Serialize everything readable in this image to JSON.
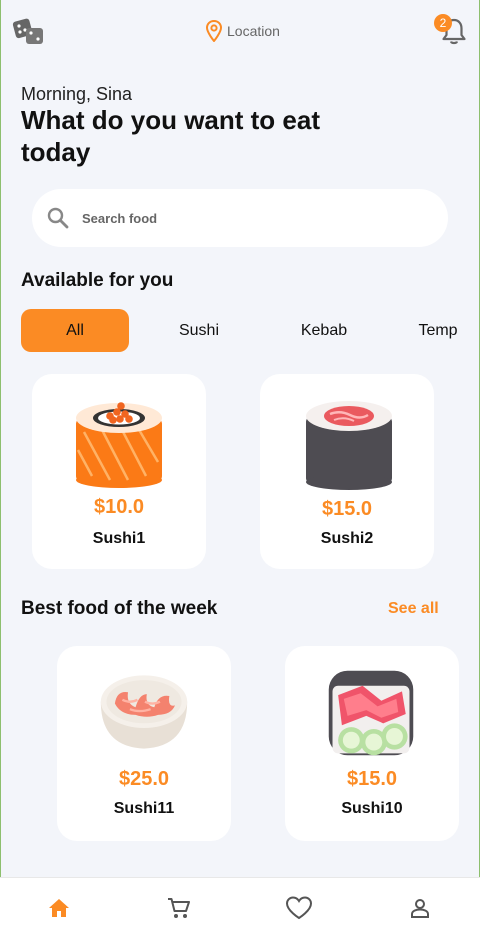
{
  "header": {
    "location_label": "Location",
    "notification_count": "2"
  },
  "greeting": "Morning, Sina",
  "headline": "What do you want to eat today",
  "search": {
    "placeholder": "Search food"
  },
  "available": {
    "title": "Available for you",
    "tabs": [
      {
        "label": "All",
        "active": true
      },
      {
        "label": "Sushi",
        "active": false
      },
      {
        "label": "Kebab",
        "active": false
      },
      {
        "label": "Temp",
        "active": false
      }
    ],
    "items": [
      {
        "price": "$10.0",
        "name": "Sushi1",
        "icon": "salmon-roll-icon"
      },
      {
        "price": "$15.0",
        "name": "Sushi2",
        "icon": "nori-roll-icon"
      }
    ]
  },
  "best": {
    "title": "Best food of the week",
    "see_all": "See all",
    "items": [
      {
        "price": "$25.0",
        "name": "Sushi11",
        "icon": "shrimp-bowl-icon"
      },
      {
        "price": "$15.0",
        "name": "Sushi10",
        "icon": "tuna-cucumber-roll-icon"
      }
    ]
  },
  "nav": [
    {
      "name": "home",
      "icon": "home-icon",
      "active": true
    },
    {
      "name": "cart",
      "icon": "cart-icon",
      "active": false
    },
    {
      "name": "favorites",
      "icon": "heart-icon",
      "active": false
    },
    {
      "name": "profile",
      "icon": "person-icon",
      "active": false
    }
  ],
  "colors": {
    "accent": "#fb8b24",
    "background": "#f3f5fa",
    "card": "#ffffff",
    "icon_gray": "#555555"
  }
}
